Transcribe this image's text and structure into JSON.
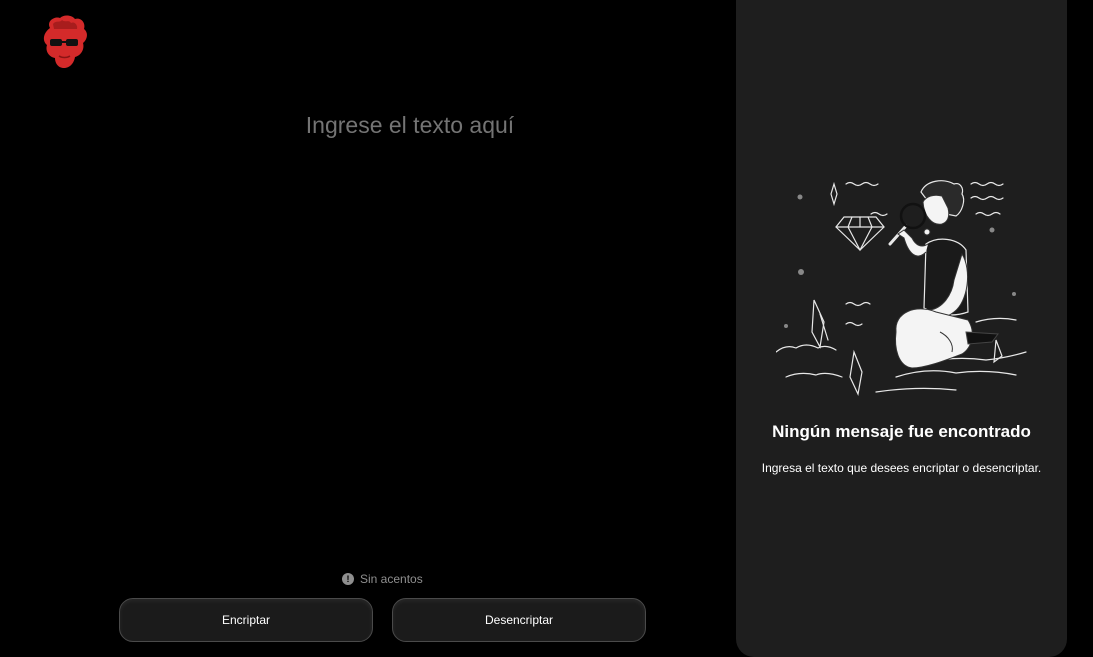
{
  "input": {
    "placeholder": "Ingrese el texto aquí",
    "value": ""
  },
  "hint": {
    "icon": "info-icon",
    "text": "Sin acentos"
  },
  "buttons": {
    "encrypt_label": "Encriptar",
    "decrypt_label": "Desencriptar"
  },
  "result_panel": {
    "title": "Ningún mensaje fue encontrado",
    "description": "Ingresa el texto que desees encriptar o desencriptar."
  },
  "colors": {
    "background": "#000000",
    "panel": "#1e1e1e",
    "button": "#1b1b1b",
    "logo_red": "#d42a2a"
  }
}
